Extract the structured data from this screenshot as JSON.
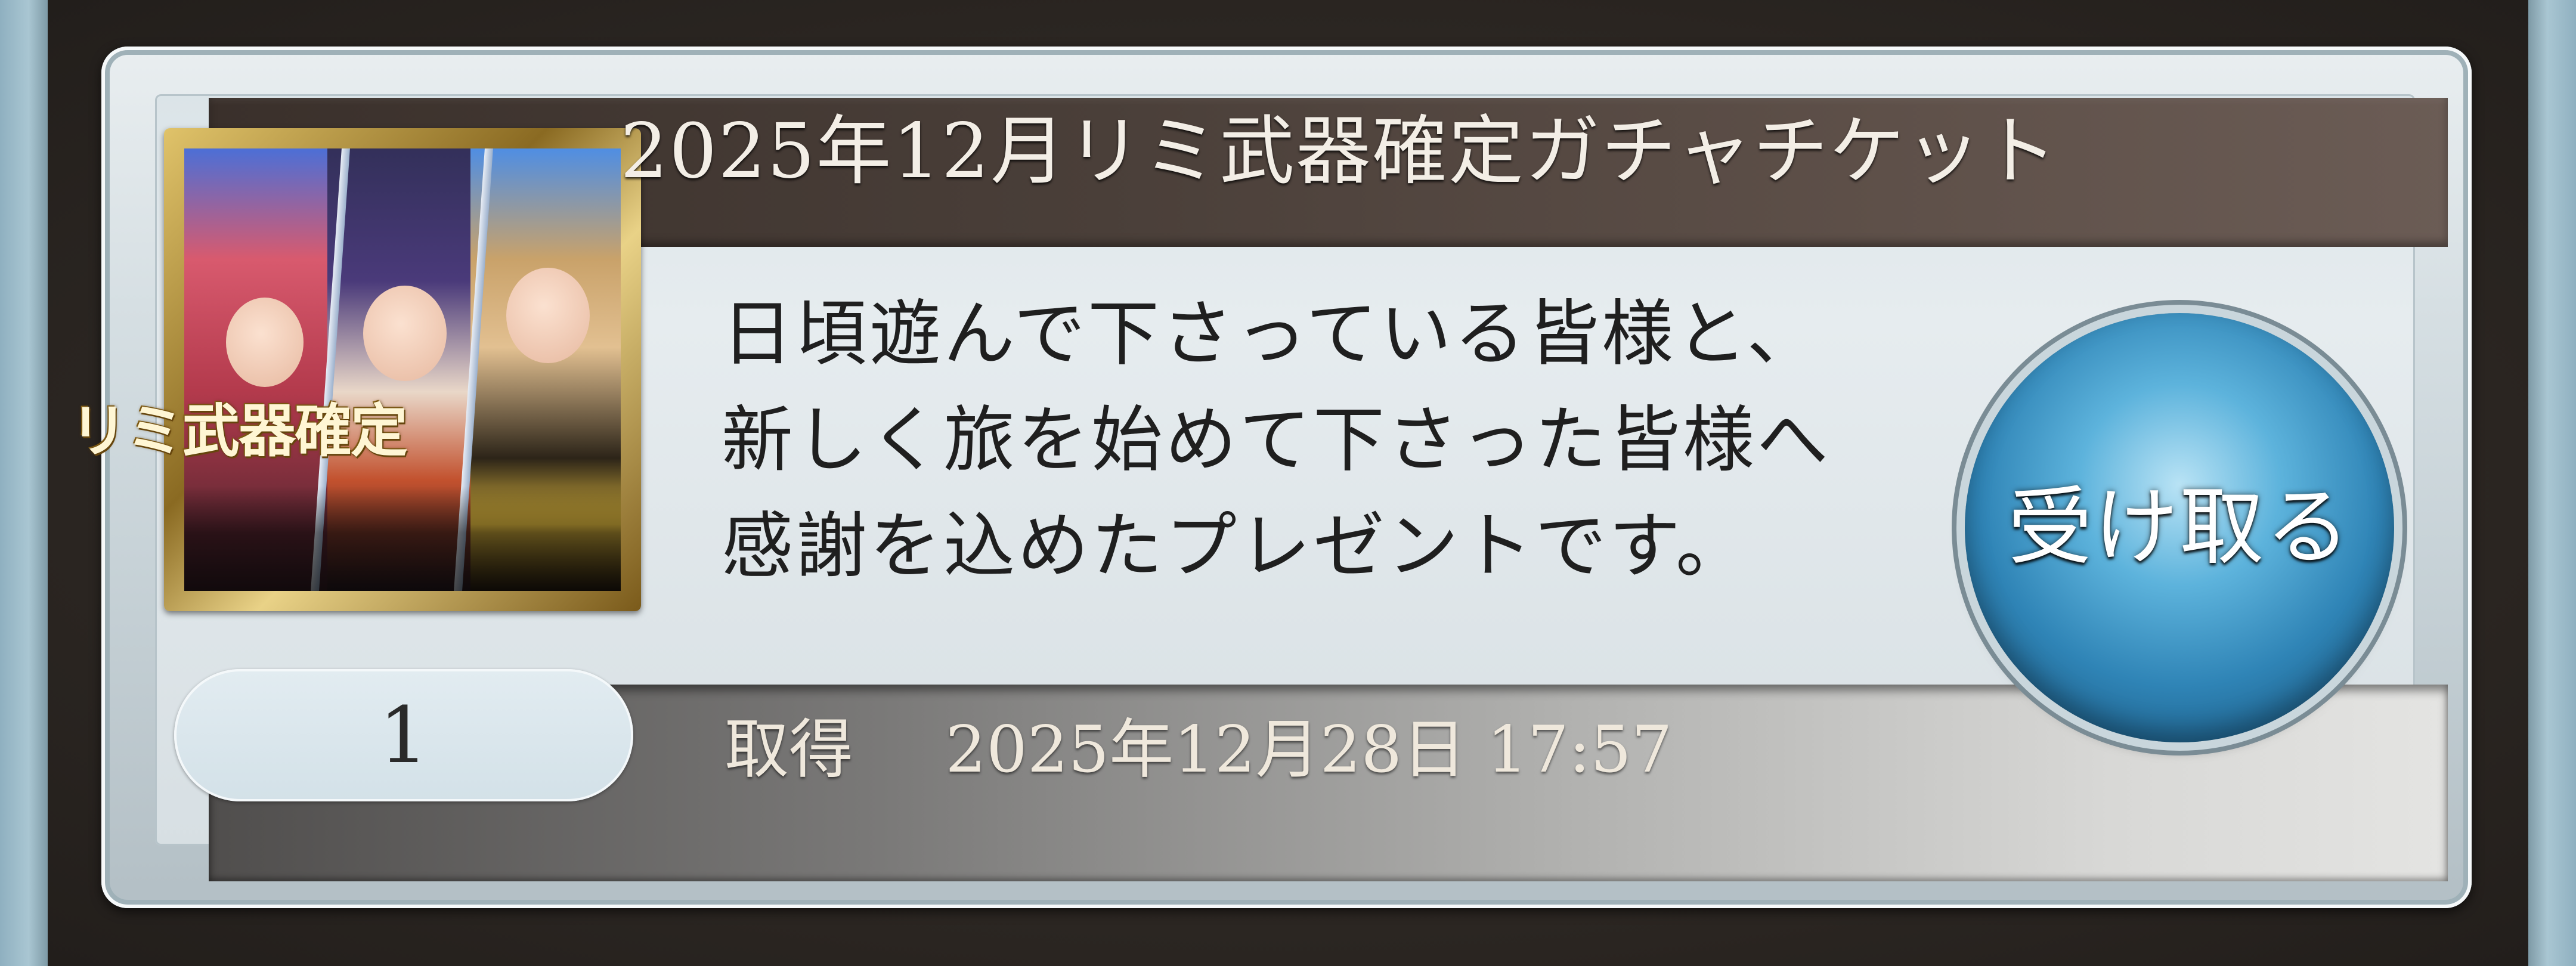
{
  "item": {
    "title": "2025年12月リミ武器確定ガチャチケット",
    "thumbnail_caption": "リミ武器確定",
    "description_lines": [
      "日頃遊んで下さっている皆様と、",
      "新しく旅を始めて下さった皆様へ",
      "感謝を込めたプレゼントです。"
    ],
    "quantity": "1",
    "acquired_label": "取得",
    "acquired_datetime": "2025年12月28日 17:57",
    "receive_label": "受け取る"
  },
  "colors": {
    "title_band": "#4a3f39",
    "receive_button": "#2f84b6",
    "card_frame": "#c7d2d7"
  }
}
